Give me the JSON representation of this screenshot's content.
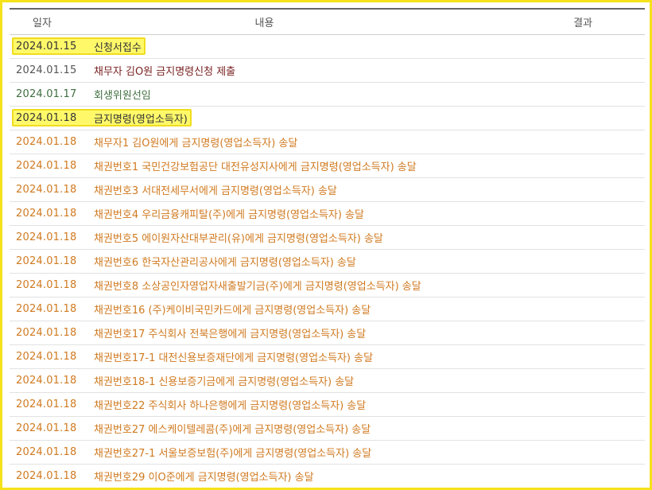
{
  "header": {
    "date": "일자",
    "content": "내용",
    "result": "결과"
  },
  "colors": {
    "frame_border": "#f5e21a",
    "highlight_fill": "#fff96a",
    "highlight_border": "#f0dd1f",
    "date_gray": "#555555",
    "dark_red": "#7a2323",
    "green": "#3f6e3f",
    "orange": "#d07a20"
  },
  "rows": [
    {
      "date": "2024.01.15",
      "content": "신청서접수",
      "color": "#333333",
      "date_color": "#333333",
      "highlight": true
    },
    {
      "date": "2024.01.15",
      "content": "채무자 김O원 금지명령신청 제출",
      "color": "#7a2323",
      "date_color": "#555555",
      "highlight": false
    },
    {
      "date": "2024.01.17",
      "content": "회생위원선임",
      "color": "#3f6e3f",
      "date_color": "#3f6e3f",
      "highlight": false
    },
    {
      "date": "2024.01.18",
      "content": "금지명령(영업소득자)",
      "color": "#333333",
      "date_color": "#333333",
      "highlight": true
    },
    {
      "date": "2024.01.18",
      "content": "채무자1 김O원에게 금지명령(영업소득자) 송달",
      "color": "#d07a20",
      "date_color": "#d07a20",
      "highlight": false
    },
    {
      "date": "2024.01.18",
      "content": "채권번호1 국민건강보험공단 대전유성지사에게 금지명령(영업소득자) 송달",
      "color": "#d07a20",
      "date_color": "#d07a20",
      "highlight": false
    },
    {
      "date": "2024.01.18",
      "content": "채권번호3 서대전세무서에게 금지명령(영업소득자) 송달",
      "color": "#d07a20",
      "date_color": "#d07a20",
      "highlight": false
    },
    {
      "date": "2024.01.18",
      "content": "채권번호4 우리금융캐피탈(주)에게 금지명령(영업소득자) 송달",
      "color": "#d07a20",
      "date_color": "#d07a20",
      "highlight": false
    },
    {
      "date": "2024.01.18",
      "content": "채권번호5 에이원자산대부관리(유)에게 금지명령(영업소득자) 송달",
      "color": "#d07a20",
      "date_color": "#d07a20",
      "highlight": false
    },
    {
      "date": "2024.01.18",
      "content": "채권번호6 한국자산관리공사에게 금지명령(영업소득자) 송달",
      "color": "#d07a20",
      "date_color": "#d07a20",
      "highlight": false
    },
    {
      "date": "2024.01.18",
      "content": "채권번호8 소상공인자영업자새출발기금(주)에게 금지명령(영업소득자) 송달",
      "color": "#d07a20",
      "date_color": "#d07a20",
      "highlight": false
    },
    {
      "date": "2024.01.18",
      "content": "채권번호16 (주)케이비국민카드에게 금지명령(영업소득자) 송달",
      "color": "#d07a20",
      "date_color": "#d07a20",
      "highlight": false
    },
    {
      "date": "2024.01.18",
      "content": "채권번호17 주식회사 전북은행에게 금지명령(영업소득자) 송달",
      "color": "#d07a20",
      "date_color": "#d07a20",
      "highlight": false
    },
    {
      "date": "2024.01.18",
      "content": "채권번호17-1 대전신용보증재단에게 금지명령(영업소득자) 송달",
      "color": "#d07a20",
      "date_color": "#d07a20",
      "highlight": false
    },
    {
      "date": "2024.01.18",
      "content": "채권번호18-1 신용보증기금에게 금지명령(영업소득자) 송달",
      "color": "#d07a20",
      "date_color": "#d07a20",
      "highlight": false
    },
    {
      "date": "2024.01.18",
      "content": "채권번호22 주식회사 하나은행에게 금지명령(영업소득자) 송달",
      "color": "#d07a20",
      "date_color": "#d07a20",
      "highlight": false
    },
    {
      "date": "2024.01.18",
      "content": "채권번호27 에스케이텔레콤(주)에게 금지명령(영업소득자) 송달",
      "color": "#d07a20",
      "date_color": "#d07a20",
      "highlight": false
    },
    {
      "date": "2024.01.18",
      "content": "채권번호27-1 서울보증보험(주)에게 금지명령(영업소득자) 송달",
      "color": "#d07a20",
      "date_color": "#d07a20",
      "highlight": false
    },
    {
      "date": "2024.01.18",
      "content": "채권번호29 이O준에게 금지명령(영업소득자) 송달",
      "color": "#d07a20",
      "date_color": "#d07a20",
      "highlight": false
    }
  ]
}
